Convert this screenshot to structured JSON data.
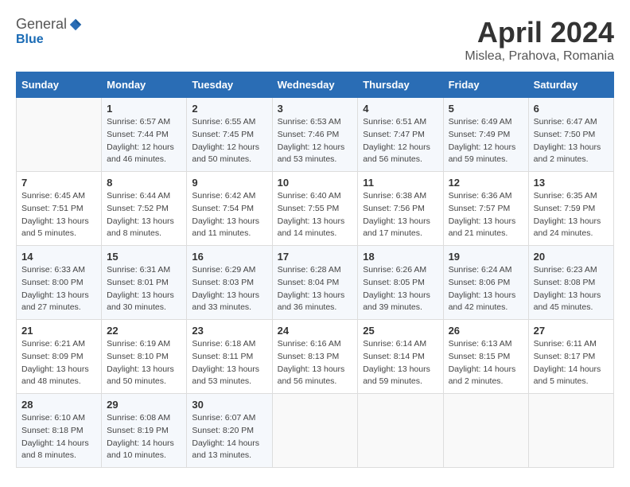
{
  "header": {
    "logo": {
      "general": "General",
      "blue": "Blue"
    },
    "title": "April 2024",
    "location": "Mislea, Prahova, Romania"
  },
  "weekdays": [
    "Sunday",
    "Monday",
    "Tuesday",
    "Wednesday",
    "Thursday",
    "Friday",
    "Saturday"
  ],
  "weeks": [
    [
      {
        "day": "",
        "sunrise": "",
        "sunset": "",
        "daylight": ""
      },
      {
        "day": "1",
        "sunrise": "Sunrise: 6:57 AM",
        "sunset": "Sunset: 7:44 PM",
        "daylight": "Daylight: 12 hours and 46 minutes."
      },
      {
        "day": "2",
        "sunrise": "Sunrise: 6:55 AM",
        "sunset": "Sunset: 7:45 PM",
        "daylight": "Daylight: 12 hours and 50 minutes."
      },
      {
        "day": "3",
        "sunrise": "Sunrise: 6:53 AM",
        "sunset": "Sunset: 7:46 PM",
        "daylight": "Daylight: 12 hours and 53 minutes."
      },
      {
        "day": "4",
        "sunrise": "Sunrise: 6:51 AM",
        "sunset": "Sunset: 7:47 PM",
        "daylight": "Daylight: 12 hours and 56 minutes."
      },
      {
        "day": "5",
        "sunrise": "Sunrise: 6:49 AM",
        "sunset": "Sunset: 7:49 PM",
        "daylight": "Daylight: 12 hours and 59 minutes."
      },
      {
        "day": "6",
        "sunrise": "Sunrise: 6:47 AM",
        "sunset": "Sunset: 7:50 PM",
        "daylight": "Daylight: 13 hours and 2 minutes."
      }
    ],
    [
      {
        "day": "7",
        "sunrise": "Sunrise: 6:45 AM",
        "sunset": "Sunset: 7:51 PM",
        "daylight": "Daylight: 13 hours and 5 minutes."
      },
      {
        "day": "8",
        "sunrise": "Sunrise: 6:44 AM",
        "sunset": "Sunset: 7:52 PM",
        "daylight": "Daylight: 13 hours and 8 minutes."
      },
      {
        "day": "9",
        "sunrise": "Sunrise: 6:42 AM",
        "sunset": "Sunset: 7:54 PM",
        "daylight": "Daylight: 13 hours and 11 minutes."
      },
      {
        "day": "10",
        "sunrise": "Sunrise: 6:40 AM",
        "sunset": "Sunset: 7:55 PM",
        "daylight": "Daylight: 13 hours and 14 minutes."
      },
      {
        "day": "11",
        "sunrise": "Sunrise: 6:38 AM",
        "sunset": "Sunset: 7:56 PM",
        "daylight": "Daylight: 13 hours and 17 minutes."
      },
      {
        "day": "12",
        "sunrise": "Sunrise: 6:36 AM",
        "sunset": "Sunset: 7:57 PM",
        "daylight": "Daylight: 13 hours and 21 minutes."
      },
      {
        "day": "13",
        "sunrise": "Sunrise: 6:35 AM",
        "sunset": "Sunset: 7:59 PM",
        "daylight": "Daylight: 13 hours and 24 minutes."
      }
    ],
    [
      {
        "day": "14",
        "sunrise": "Sunrise: 6:33 AM",
        "sunset": "Sunset: 8:00 PM",
        "daylight": "Daylight: 13 hours and 27 minutes."
      },
      {
        "day": "15",
        "sunrise": "Sunrise: 6:31 AM",
        "sunset": "Sunset: 8:01 PM",
        "daylight": "Daylight: 13 hours and 30 minutes."
      },
      {
        "day": "16",
        "sunrise": "Sunrise: 6:29 AM",
        "sunset": "Sunset: 8:03 PM",
        "daylight": "Daylight: 13 hours and 33 minutes."
      },
      {
        "day": "17",
        "sunrise": "Sunrise: 6:28 AM",
        "sunset": "Sunset: 8:04 PM",
        "daylight": "Daylight: 13 hours and 36 minutes."
      },
      {
        "day": "18",
        "sunrise": "Sunrise: 6:26 AM",
        "sunset": "Sunset: 8:05 PM",
        "daylight": "Daylight: 13 hours and 39 minutes."
      },
      {
        "day": "19",
        "sunrise": "Sunrise: 6:24 AM",
        "sunset": "Sunset: 8:06 PM",
        "daylight": "Daylight: 13 hours and 42 minutes."
      },
      {
        "day": "20",
        "sunrise": "Sunrise: 6:23 AM",
        "sunset": "Sunset: 8:08 PM",
        "daylight": "Daylight: 13 hours and 45 minutes."
      }
    ],
    [
      {
        "day": "21",
        "sunrise": "Sunrise: 6:21 AM",
        "sunset": "Sunset: 8:09 PM",
        "daylight": "Daylight: 13 hours and 48 minutes."
      },
      {
        "day": "22",
        "sunrise": "Sunrise: 6:19 AM",
        "sunset": "Sunset: 8:10 PM",
        "daylight": "Daylight: 13 hours and 50 minutes."
      },
      {
        "day": "23",
        "sunrise": "Sunrise: 6:18 AM",
        "sunset": "Sunset: 8:11 PM",
        "daylight": "Daylight: 13 hours and 53 minutes."
      },
      {
        "day": "24",
        "sunrise": "Sunrise: 6:16 AM",
        "sunset": "Sunset: 8:13 PM",
        "daylight": "Daylight: 13 hours and 56 minutes."
      },
      {
        "day": "25",
        "sunrise": "Sunrise: 6:14 AM",
        "sunset": "Sunset: 8:14 PM",
        "daylight": "Daylight: 13 hours and 59 minutes."
      },
      {
        "day": "26",
        "sunrise": "Sunrise: 6:13 AM",
        "sunset": "Sunset: 8:15 PM",
        "daylight": "Daylight: 14 hours and 2 minutes."
      },
      {
        "day": "27",
        "sunrise": "Sunrise: 6:11 AM",
        "sunset": "Sunset: 8:17 PM",
        "daylight": "Daylight: 14 hours and 5 minutes."
      }
    ],
    [
      {
        "day": "28",
        "sunrise": "Sunrise: 6:10 AM",
        "sunset": "Sunset: 8:18 PM",
        "daylight": "Daylight: 14 hours and 8 minutes."
      },
      {
        "day": "29",
        "sunrise": "Sunrise: 6:08 AM",
        "sunset": "Sunset: 8:19 PM",
        "daylight": "Daylight: 14 hours and 10 minutes."
      },
      {
        "day": "30",
        "sunrise": "Sunrise: 6:07 AM",
        "sunset": "Sunset: 8:20 PM",
        "daylight": "Daylight: 14 hours and 13 minutes."
      },
      {
        "day": "",
        "sunrise": "",
        "sunset": "",
        "daylight": ""
      },
      {
        "day": "",
        "sunrise": "",
        "sunset": "",
        "daylight": ""
      },
      {
        "day": "",
        "sunrise": "",
        "sunset": "",
        "daylight": ""
      },
      {
        "day": "",
        "sunrise": "",
        "sunset": "",
        "daylight": ""
      }
    ]
  ]
}
